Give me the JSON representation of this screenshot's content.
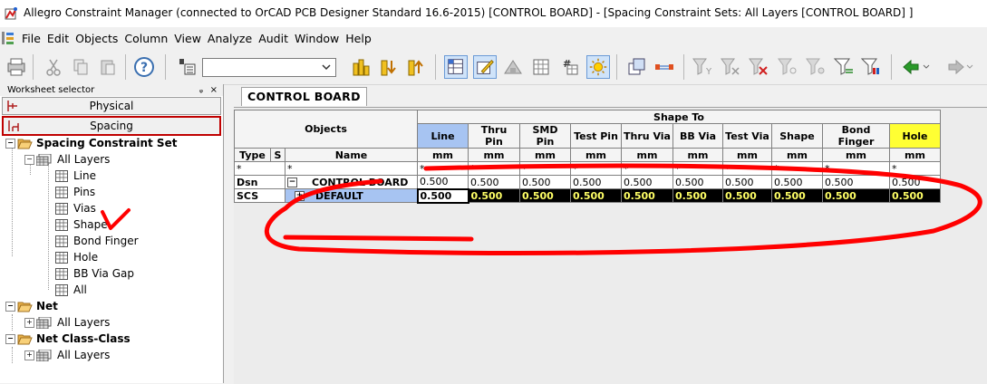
{
  "window": {
    "title": "Allegro Constraint Manager (connected to OrCAD PCB Designer Standard 16.6-2015) [CONTROL BOARD] - [Spacing Constraint Sets:  All Layers [CONTROL BOARD] ]"
  },
  "menu": {
    "items": [
      "File",
      "Edit",
      "Objects",
      "Column",
      "View",
      "Analyze",
      "Audit",
      "Window",
      "Help"
    ]
  },
  "toolbar": {
    "combo_value": ""
  },
  "worksheet_selector": {
    "title": "Worksheet selector",
    "pin": "ᵩ",
    "close": "×",
    "physical_label": "Physical",
    "spacing_label": "Spacing"
  },
  "tree": {
    "spacing_constraint_set": "Spacing Constraint Set",
    "all_layers_1": "All Layers",
    "children": [
      "Line",
      "Pins",
      "Vias",
      "Shape",
      "Bond Finger",
      "Hole",
      "BB Via Gap",
      "All"
    ],
    "net": "Net",
    "all_layers_2": "All Layers",
    "net_class_class": "Net Class-Class",
    "all_layers_3": "All Layers"
  },
  "tab": {
    "label": "CONTROL BOARD"
  },
  "grid": {
    "objects_header": "Objects",
    "shape_to_header": "Shape To",
    "type_header": "Type",
    "s_header": "S",
    "name_header": "Name",
    "columns": [
      "Line",
      "Thru Pin",
      "SMD Pin",
      "Test Pin",
      "Thru Via",
      "BB Via",
      "Test Via",
      "Shape",
      "Bond Finger",
      "Hole"
    ],
    "unit": "mm",
    "filter": "*",
    "rows": [
      {
        "type": "Dsn",
        "expander": "−",
        "name": "CONTROL BOARD",
        "values": [
          "0.500",
          "0.500",
          "0.500",
          "0.500",
          "0.500",
          "0.500",
          "0.500",
          "0.500",
          "0.500",
          "0.500"
        ]
      },
      {
        "type": "SCS",
        "expander": "+",
        "name": "DEFAULT",
        "values": [
          "0.500",
          "0.500",
          "0.500",
          "0.500",
          "0.500",
          "0.500",
          "0.500",
          "0.500",
          "0.500",
          "0.500"
        ]
      }
    ]
  },
  "colors": {
    "highlight_blue": "#a7c4f2",
    "highlight_yellow": "#ffff33",
    "annotation_red": "#ff0000"
  }
}
